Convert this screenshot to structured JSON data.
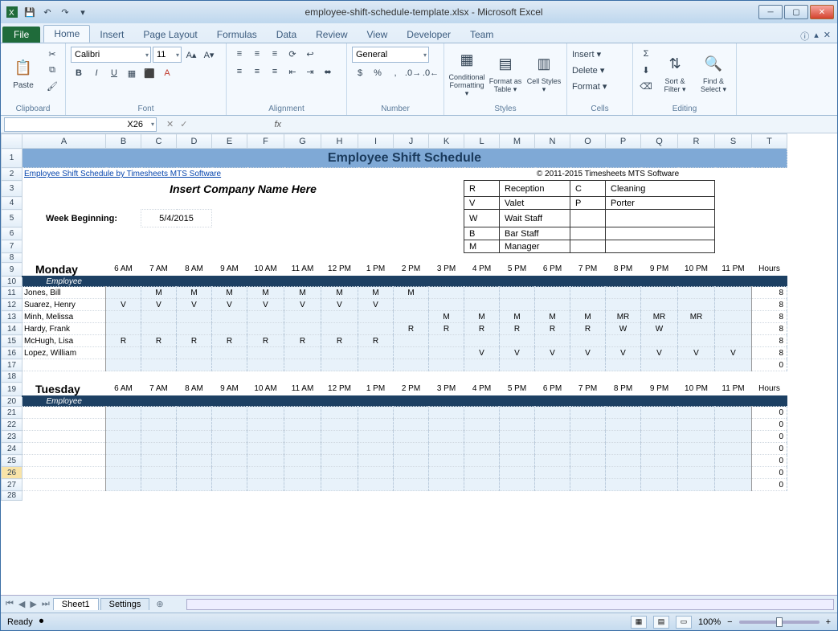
{
  "window": {
    "title": "employee-shift-schedule-template.xlsx - Microsoft Excel"
  },
  "ribbon": {
    "file": "File",
    "tabs": [
      "Home",
      "Insert",
      "Page Layout",
      "Formulas",
      "Data",
      "Review",
      "View",
      "Developer",
      "Team"
    ],
    "active_tab": "Home",
    "groups": {
      "clipboard": "Clipboard",
      "font": "Font",
      "alignment": "Alignment",
      "number": "Number",
      "styles": "Styles",
      "cells": "Cells",
      "editing": "Editing"
    },
    "paste": "Paste",
    "font_name": "Calibri",
    "font_size": "11",
    "number_format": "General",
    "cond_fmt": "Conditional Formatting ▾",
    "fmt_table": "Format as Table ▾",
    "cell_styles": "Cell Styles ▾",
    "insert": "Insert ▾",
    "delete": "Delete ▾",
    "format": "Format ▾",
    "sort_filter": "Sort & Filter ▾",
    "find_select": "Find & Select ▾"
  },
  "namebox": "X26",
  "columns": [
    "A",
    "B",
    "C",
    "D",
    "E",
    "F",
    "G",
    "H",
    "I",
    "J",
    "K",
    "L",
    "M",
    "N",
    "O",
    "P",
    "Q",
    "R",
    "S",
    "T"
  ],
  "sheet": {
    "title": "Employee Shift Schedule",
    "link": "Employee Shift Schedule by Timesheets MTS Software",
    "copyright": "© 2011-2015 Timesheets MTS Software",
    "company": "Insert Company Name Here",
    "week_label": "Week Beginning:",
    "week_date": "5/4/2015",
    "legend": [
      {
        "c": "R",
        "n": "Reception"
      },
      {
        "c": "V",
        "n": "Valet"
      },
      {
        "c": "W",
        "n": "Wait Staff"
      },
      {
        "c": "B",
        "n": "Bar Staff"
      },
      {
        "c": "M",
        "n": "Manager"
      },
      {
        "c": "C",
        "n": "Cleaning"
      },
      {
        "c": "P",
        "n": "Porter"
      }
    ],
    "times": [
      "6 AM",
      "7 AM",
      "8 AM",
      "9 AM",
      "10 AM",
      "11 AM",
      "12 PM",
      "1 PM",
      "2 PM",
      "3 PM",
      "4 PM",
      "5 PM",
      "6 PM",
      "7 PM",
      "8 PM",
      "9 PM",
      "10 PM",
      "11 PM"
    ],
    "hours_label": "Hours",
    "employee_label": "Employee",
    "days": [
      "Monday",
      "Tuesday"
    ],
    "monday": [
      {
        "name": "Jones, Bill",
        "shifts": [
          "",
          "M",
          "M",
          "M",
          "M",
          "M",
          "M",
          "M",
          "M",
          "",
          "",
          "",
          "",
          "",
          "",
          "",
          "",
          ""
        ],
        "hours": "8"
      },
      {
        "name": "Suarez, Henry",
        "shifts": [
          "V",
          "V",
          "V",
          "V",
          "V",
          "V",
          "V",
          "V",
          "",
          "",
          "",
          "",
          "",
          "",
          "",
          "",
          "",
          ""
        ],
        "hours": "8"
      },
      {
        "name": "Minh, Melissa",
        "shifts": [
          "",
          "",
          "",
          "",
          "",
          "",
          "",
          "",
          "",
          "M",
          "M",
          "M",
          "M",
          "M",
          "MR",
          "MR",
          "MR",
          ""
        ],
        "hours": "8"
      },
      {
        "name": "Hardy, Frank",
        "shifts": [
          "",
          "",
          "",
          "",
          "",
          "",
          "",
          "",
          "R",
          "R",
          "R",
          "R",
          "R",
          "R",
          "W",
          "W",
          "",
          ""
        ],
        "hours": "8"
      },
      {
        "name": "McHugh, Lisa",
        "shifts": [
          "R",
          "R",
          "R",
          "R",
          "R",
          "R",
          "R",
          "R",
          "",
          "",
          "",
          "",
          "",
          "",
          "",
          "",
          "",
          ""
        ],
        "hours": "8"
      },
      {
        "name": "Lopez, William",
        "shifts": [
          "",
          "",
          "",
          "",
          "",
          "",
          "",
          "",
          "",
          "",
          "V",
          "V",
          "V",
          "V",
          "V",
          "V",
          "V",
          "V"
        ],
        "hours": "8"
      }
    ],
    "monday_total": "0",
    "tuesday_hours": [
      "0",
      "0",
      "0",
      "0",
      "0",
      "0",
      "0"
    ]
  },
  "sheet_tabs": [
    "Sheet1",
    "Settings"
  ],
  "status": {
    "ready": "Ready",
    "zoom": "100%"
  }
}
